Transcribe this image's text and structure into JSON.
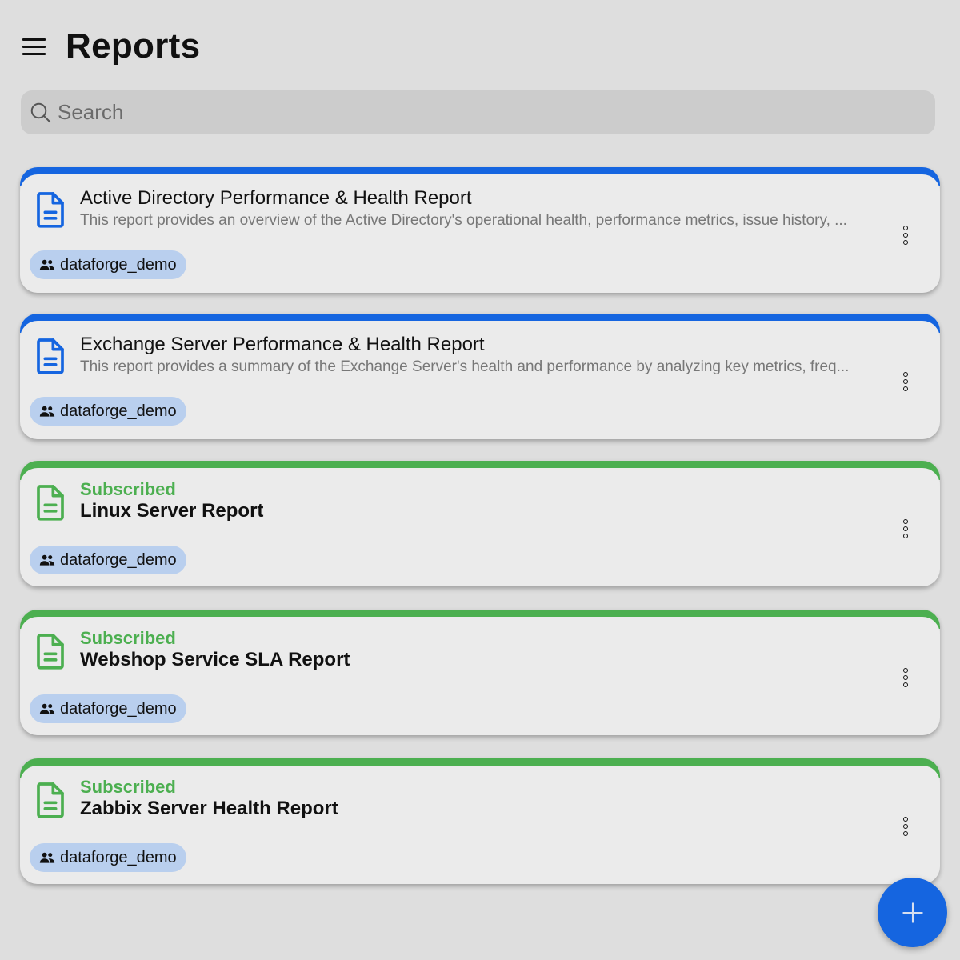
{
  "header": {
    "title": "Reports",
    "menu_icon": "hamburger-menu-icon"
  },
  "search": {
    "placeholder": "Search",
    "value": "",
    "icon": "search-icon"
  },
  "colors": {
    "accent_blue": "#1565e0",
    "subscribed_green": "#4caf50",
    "chip_bg": "#b9cfee",
    "card_bg": "#ebebeb",
    "page_bg": "#dedede"
  },
  "reports": [
    {
      "title": "Active Directory Performance & Health Report",
      "description": "This report provides an overview of the Active Directory's operational health, performance metrics, issue history, ...",
      "status": "",
      "subscribed": false,
      "owner": "dataforge_demo",
      "icon": "document-icon",
      "more_icon": "more-vertical-icon"
    },
    {
      "title": "Exchange Server Performance & Health Report",
      "description": "This report provides a summary of the Exchange Server's health and performance by analyzing key metrics, freq...",
      "status": "",
      "subscribed": false,
      "owner": "dataforge_demo",
      "icon": "document-icon",
      "more_icon": "more-vertical-icon"
    },
    {
      "title": "Linux Server Report",
      "description": "",
      "status": "Subscribed",
      "subscribed": true,
      "owner": "dataforge_demo",
      "icon": "document-icon",
      "more_icon": "more-vertical-icon"
    },
    {
      "title": "Webshop Service SLA Report",
      "description": "",
      "status": "Subscribed",
      "subscribed": true,
      "owner": "dataforge_demo",
      "icon": "document-icon",
      "more_icon": "more-vertical-icon"
    },
    {
      "title": "Zabbix Server Health Report",
      "description": "",
      "status": "Subscribed",
      "subscribed": true,
      "owner": "dataforge_demo",
      "icon": "document-icon",
      "more_icon": "more-vertical-icon"
    }
  ],
  "fab": {
    "label": "Add report",
    "icon": "plus-icon"
  }
}
